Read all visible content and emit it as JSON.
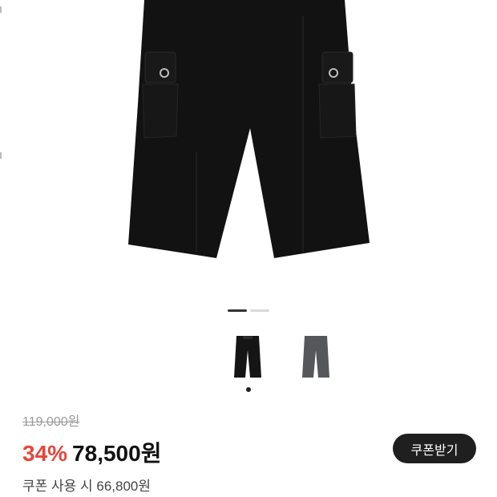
{
  "product": {
    "images": [
      {
        "icon": "black-cargo-pants-image",
        "color": "#1a1a1a"
      },
      {
        "icon": "gray-cargo-pants-image",
        "color": "#55575b"
      }
    ]
  },
  "pricing": {
    "original": "119,000원",
    "discount": "34%",
    "sale": "78,500원",
    "coupon_price": "쿠폰 사용 시 66,800원"
  },
  "actions": {
    "coupon_button": "쿠폰받기"
  }
}
